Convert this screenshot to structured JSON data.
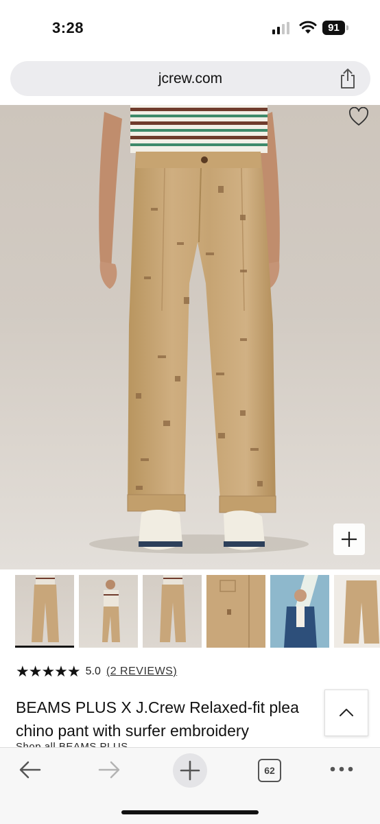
{
  "status_bar": {
    "time": "3:28",
    "battery": "91"
  },
  "browser": {
    "url": "jcrew.com",
    "open_tabs": "62"
  },
  "product": {
    "rating_stars": "★★★★★",
    "rating_value": "5.0",
    "reviews_link": "(2 REVIEWS)",
    "title_line1": "BEAMS PLUS X J.Crew Relaxed-fit plea",
    "title_line2": "chino pant with surfer embroidery",
    "brand_peek": "Shop all BEAMS PLUS",
    "thumbnails": [
      "front view",
      "model side view",
      "front view full",
      "pocket detail",
      "model holding surfboard",
      "flat lay"
    ]
  },
  "icons": {
    "share": "share-icon",
    "wishlist": "heart-icon",
    "zoom": "plus-icon",
    "scroll_top": "chevron-up-icon",
    "back": "arrow-left-icon",
    "forward": "arrow-right-icon",
    "new_tab": "plus-icon",
    "tabs": "tabs-icon",
    "more": "more-icon"
  },
  "colors": {
    "chino": "#c8a67a",
    "background": "#d2cbc3",
    "accent": "#111111"
  }
}
